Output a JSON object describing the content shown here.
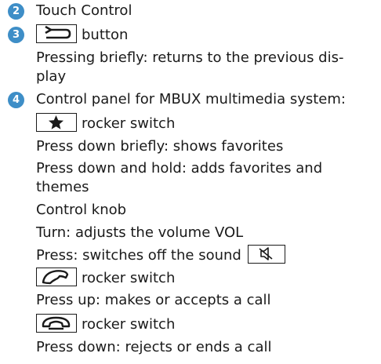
{
  "items": [
    {
      "number": "2",
      "text": "Touch Control"
    },
    {
      "number": "3",
      "button_icon": "back-arrow-icon",
      "button_label": "button",
      "lines": [
        "Pressing briefly: returns to the previous dis-",
        "play"
      ]
    },
    {
      "number": "4",
      "text": "Control panel for MBUX multimedia system:",
      "rocker_favorites": {
        "icon": "star-icon",
        "label": "rocker switch",
        "lines": [
          "Press down briefly: shows favorites",
          "Press down and hold: adds favorites and",
          "themes"
        ]
      },
      "control_knob": {
        "title": "Control knob",
        "lines": [
          "Turn: adjusts the volume VOL",
          "Press: switches off the sound"
        ],
        "mute_icon": "mute-speaker-icon"
      },
      "rocker_call_accept": {
        "icon": "phone-pickup-icon",
        "label": "rocker switch",
        "line": "Press up: makes or accepts a call"
      },
      "rocker_call_end": {
        "icon": "phone-hangup-icon",
        "label": "rocker switch",
        "line": "Press down: rejects or ends a call"
      }
    }
  ],
  "colors": {
    "badge": "#3e8ec7",
    "text": "#1a1a1a"
  }
}
